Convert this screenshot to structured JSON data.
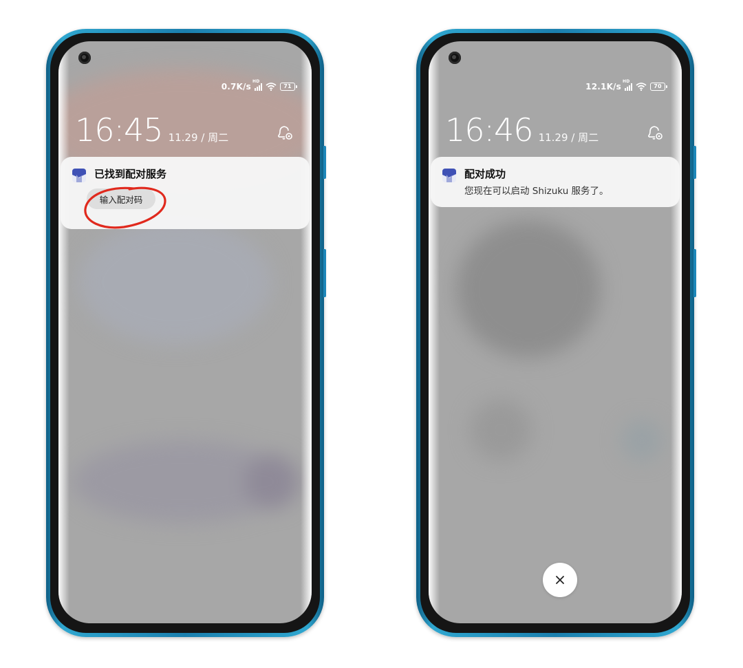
{
  "phones": [
    {
      "status": {
        "speed": "0.7K/s",
        "network_badge": "HD",
        "battery": "71"
      },
      "clock": {
        "time": "16:45",
        "date": "11.29 / 周二"
      },
      "notification": {
        "title": "已找到配对服务",
        "action_label": "输入配对码"
      },
      "annotation_color": "#e0291d"
    },
    {
      "status": {
        "speed": "12.1K/s",
        "network_badge": "HD",
        "battery": "70"
      },
      "clock": {
        "time": "16:46",
        "date": "11.29 / 周二"
      },
      "notification": {
        "title": "配对成功",
        "body": "您现在可以启动 Shizuku 服务了。"
      },
      "dismiss_icon": "close-icon"
    }
  ],
  "colors": {
    "frame": "#1b7fae",
    "app_icon_primary": "#3f51b5",
    "app_icon_secondary": "#e8eaf6"
  }
}
